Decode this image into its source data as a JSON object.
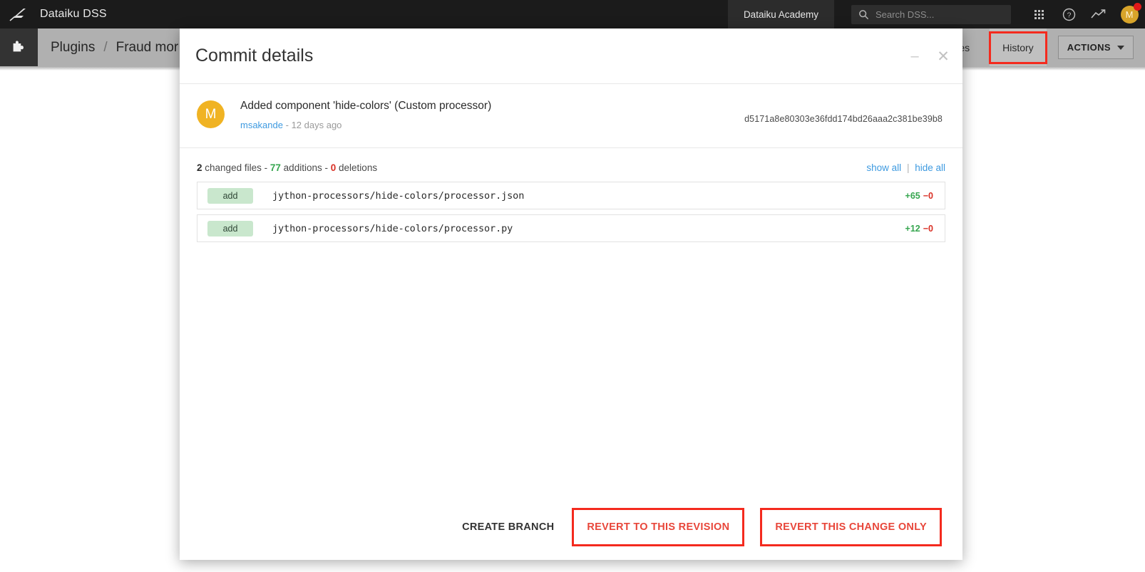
{
  "topnav": {
    "brand": "Dataiku DSS",
    "logo_icon": "dataiku-bird-logo-icon",
    "academy_label": "Dataiku Academy",
    "search": {
      "placeholder": "Search DSS...",
      "value": "",
      "icon": "search-icon"
    },
    "icons": [
      "apps-grid-icon",
      "help-circle-icon",
      "trending-up-icon"
    ],
    "avatar": {
      "initial": "M",
      "color": "#d8a42a",
      "notification": true,
      "notification_color": "#e01919"
    }
  },
  "secondbar": {
    "plugin_icon": "puzzle-piece-icon",
    "breadcrumb": {
      "root": "Plugins",
      "separator": "/",
      "current": "Fraud mor"
    },
    "tabs": [
      {
        "label": "Usages",
        "active": false,
        "highlighted": false
      },
      {
        "label": "History",
        "active": true,
        "highlighted": true
      }
    ],
    "actions_label": "ACTIONS",
    "actions_caret": "chevron-down-icon",
    "highlight_color": "#f42a1e"
  },
  "modal": {
    "title": "Commit details",
    "minimize_icon": "minimize-icon",
    "close_icon": "close-icon",
    "commit": {
      "avatar_initial": "M",
      "avatar_color": "#f0b323",
      "message": "Added component 'hide-colors' (Custom processor)",
      "author": "msakande",
      "time_separator": "-",
      "time": "12 days ago",
      "hash": "d5171a8e80303e36fdd174bd26aaa2c381be39b8"
    },
    "files_summary": {
      "files_count": "2",
      "files_label": "changed files",
      "dash1": "-",
      "additions_count": "77",
      "additions_label": "additions",
      "dash2": "-",
      "deletions_count": "0",
      "deletions_label": "deletions",
      "show_all": "show all",
      "pipe": "|",
      "hide_all": "hide all"
    },
    "files": [
      {
        "status": "add",
        "path": "jython-processors/hide-colors/processor.json",
        "additions": "+65",
        "deletions": "−0"
      },
      {
        "status": "add",
        "path": "jython-processors/hide-colors/processor.py",
        "additions": "+12",
        "deletions": "−0"
      }
    ],
    "footer": {
      "create_branch": "CREATE BRANCH",
      "revert_revision": "REVERT TO THIS REVISION",
      "revert_change": "REVERT THIS CHANGE ONLY"
    }
  }
}
